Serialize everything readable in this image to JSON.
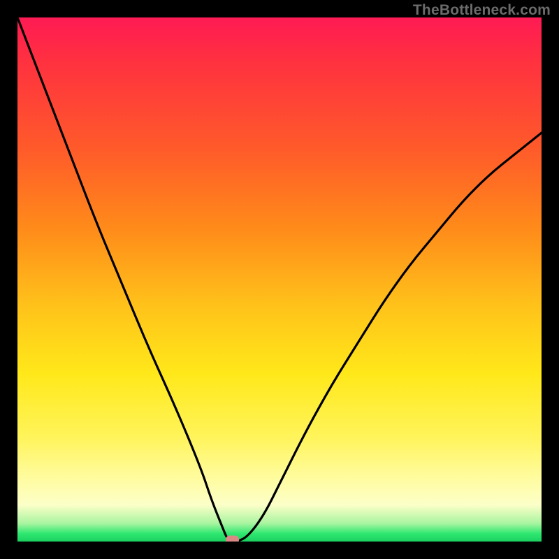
{
  "watermark": "TheBottleneck.com",
  "colors": {
    "frame": "#000000",
    "curve": "#000000",
    "marker": "#d98886",
    "gradient_top": "#ff1a54",
    "gradient_bottom": "#1ad060"
  },
  "chart_data": {
    "type": "line",
    "title": "",
    "xlabel": "",
    "ylabel": "",
    "xlim": [
      0,
      100
    ],
    "ylim": [
      0,
      100
    ],
    "grid": false,
    "legend": false,
    "x": [
      0,
      5,
      10,
      15,
      20,
      25,
      30,
      35,
      37,
      39,
      40,
      41,
      42,
      44,
      47,
      50,
      55,
      60,
      65,
      70,
      75,
      80,
      85,
      90,
      95,
      100
    ],
    "values": [
      100,
      87,
      74,
      61,
      49,
      37,
      26,
      14,
      8,
      3,
      0.5,
      0,
      0,
      1,
      5,
      11,
      21,
      30,
      38,
      46,
      53,
      59,
      65,
      70,
      74,
      78
    ],
    "annotations": [
      {
        "type": "marker",
        "x": 41,
        "y": 0,
        "shape": "rounded-rect"
      }
    ],
    "notes": "V-shaped bottleneck curve. Minimum near x≈41. Right branch rises with gentle concave taper; left branch nearly linear descent from top-left corner."
  }
}
